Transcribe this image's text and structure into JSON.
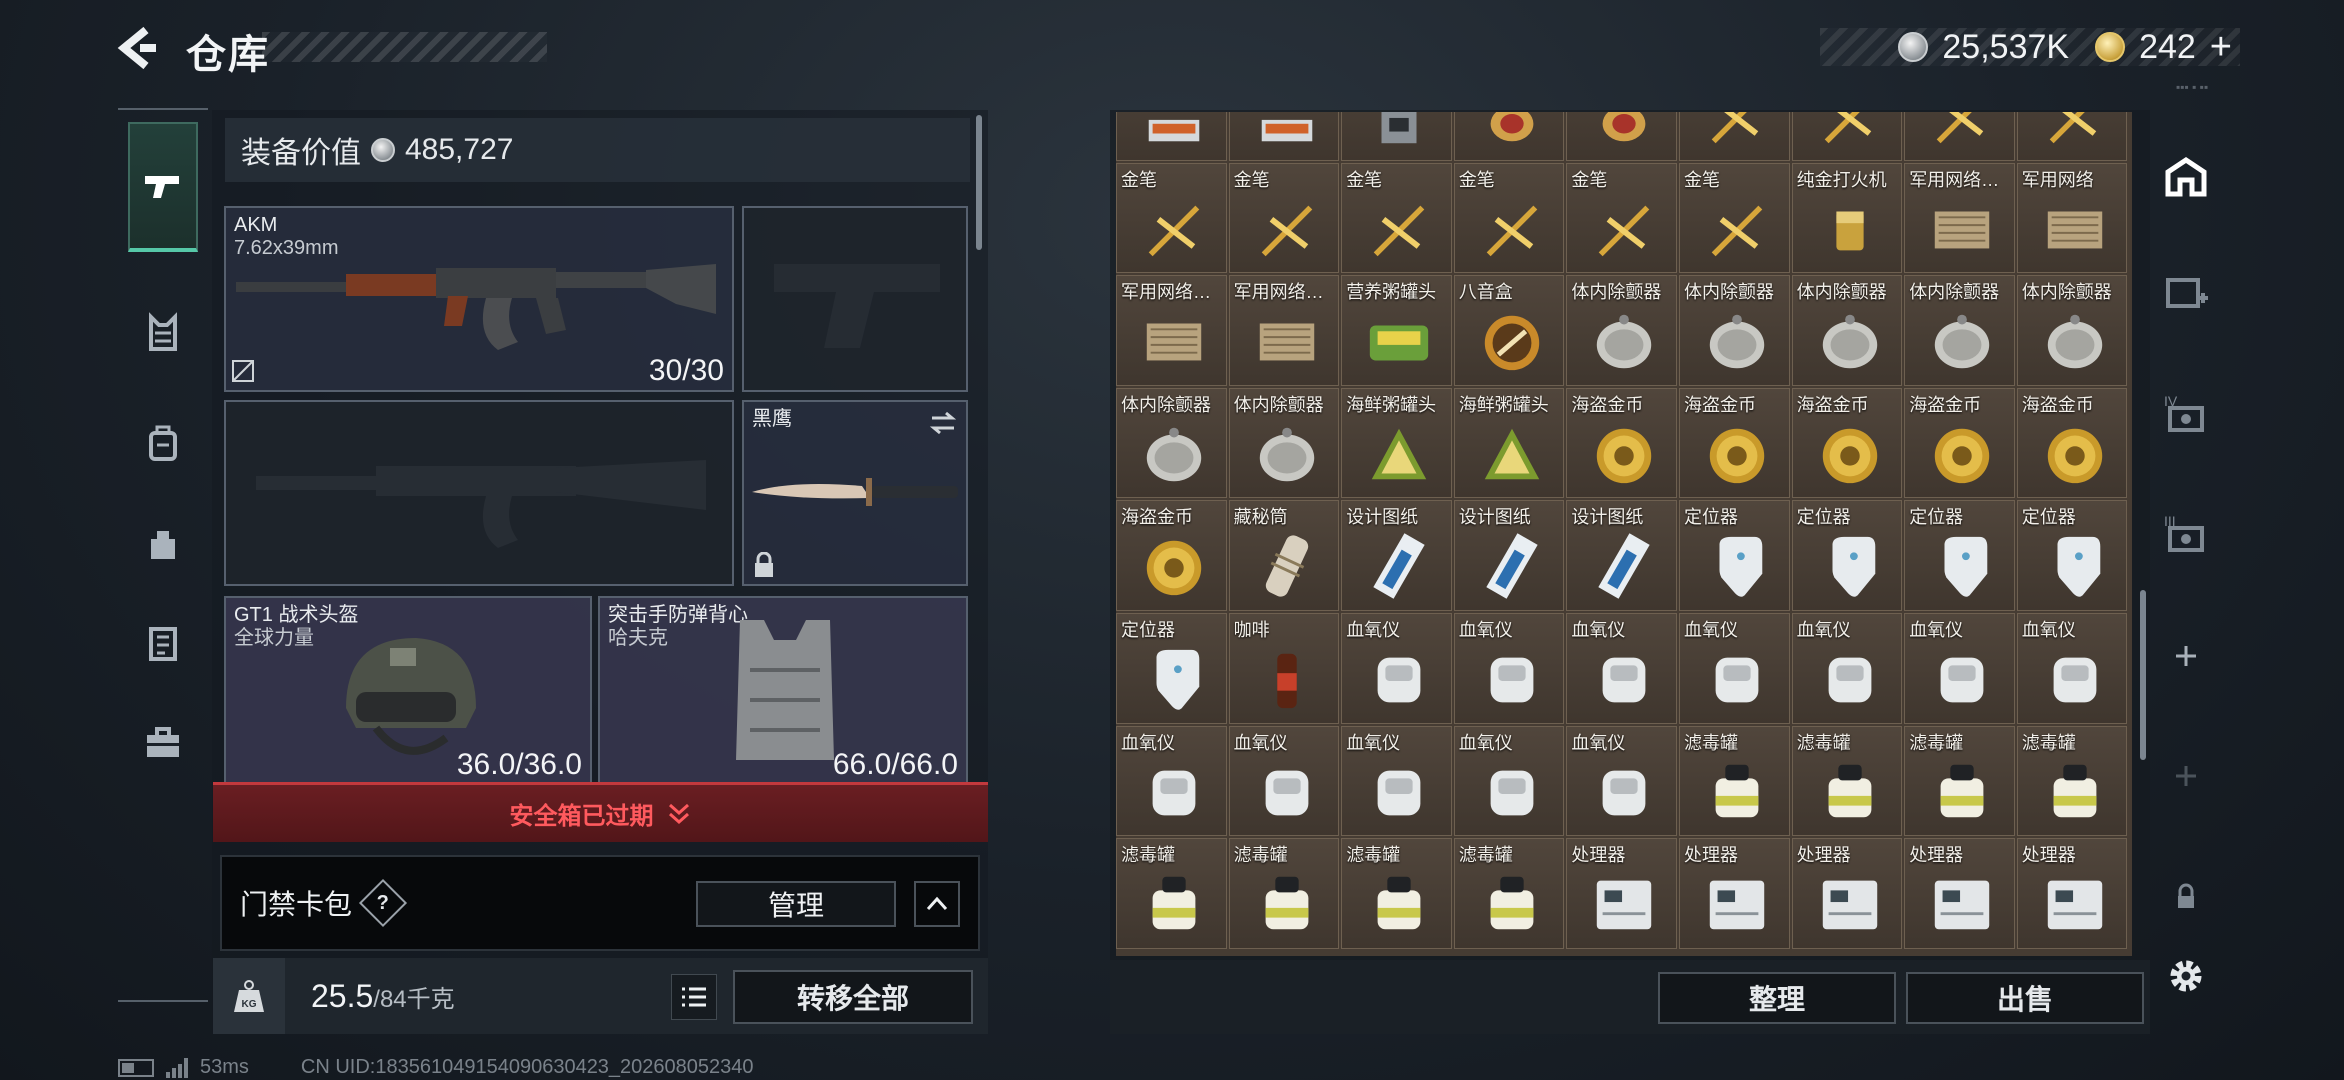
{
  "header": {
    "title": "仓库",
    "currencies": [
      {
        "icon": "silver-coin-icon",
        "value": "25,537K"
      },
      {
        "icon": "gold-coin-icon",
        "value": "242",
        "add": "+"
      }
    ]
  },
  "left_tabs": [
    {
      "name": "weapons",
      "icon": "pistol-icon",
      "active": true
    },
    {
      "name": "armor-rig",
      "icon": "chest-rig-icon"
    },
    {
      "name": "backpack",
      "icon": "backpack-icon"
    },
    {
      "name": "bag",
      "icon": "pouch-icon"
    },
    {
      "name": "clipboard",
      "icon": "clipboard-icon"
    },
    {
      "name": "toolbox",
      "icon": "briefcase-icon"
    }
  ],
  "equipment": {
    "value_label": "装备价值",
    "value": "485,727",
    "primary_weapon": {
      "name": "AKM",
      "ammo_type": "7.62x39mm",
      "ammo": "30/30"
    },
    "melee": {
      "name": "黑鹰"
    },
    "helmet": {
      "name": "GT1 战术头盔",
      "brand": "全球力量",
      "durability": "36.0/36.0"
    },
    "vest": {
      "name": "突击手防弹背心",
      "brand": "哈夫克",
      "durability": "66.0/66.0"
    }
  },
  "safebox": {
    "label": "安全箱已过期"
  },
  "keycard": {
    "label": "门禁卡包",
    "help": "?",
    "manage": "管理"
  },
  "weight": {
    "current": "25.5",
    "max": "/84千克",
    "icon_text": "KG"
  },
  "transfer_all": "转移全部",
  "status": {
    "ping": "53ms",
    "uid": "CN UID:1835610491540906304​23_202608052340"
  },
  "stash": {
    "rows": [
      [
        "",
        "",
        "",
        "",
        "",
        "",
        "",
        "",
        ""
      ],
      [
        "金笔",
        "金笔",
        "金笔",
        "金笔",
        "金笔",
        "金笔",
        "纯金打火机",
        "军用网络…",
        "军用网络"
      ],
      [
        "军用网络…",
        "军用网络…",
        "营养粥罐头",
        "八音盒",
        "体内除颤器",
        "体内除颤器",
        "体内除颤器",
        "体内除颤器",
        "体内除颤器"
      ],
      [
        "体内除颤器",
        "体内除颤器",
        "海鲜粥罐头",
        "海鲜粥罐头",
        "海盗金币",
        "海盗金币",
        "海盗金币",
        "海盗金币",
        "海盗金币"
      ],
      [
        "海盗金币",
        "藏秘筒",
        "设计图纸",
        "设计图纸",
        "设计图纸",
        "定位器",
        "定位器",
        "定位器",
        "定位器"
      ],
      [
        "定位器",
        "咖啡",
        "血氧仪",
        "血氧仪",
        "血氧仪",
        "血氧仪",
        "血氧仪",
        "血氧仪",
        "血氧仪"
      ],
      [
        "血氧仪",
        "血氧仪",
        "血氧仪",
        "血氧仪",
        "血氧仪",
        "滤毒罐",
        "滤毒罐",
        "滤毒罐",
        "滤毒罐"
      ],
      [
        "滤毒罐",
        "滤毒罐",
        "滤毒罐",
        "滤毒罐",
        "处理器",
        "处理器",
        "处理器",
        "处理器",
        "处理器"
      ]
    ],
    "top_row_art": [
      "ammo",
      "ammo",
      "device",
      "teapot",
      "teapot",
      "pen",
      "pen",
      "pen",
      "pen"
    ]
  },
  "actions": {
    "organize": "整理",
    "sell": "出售"
  },
  "right_tabs": [
    {
      "icon": "stash-home-icon",
      "active": true
    },
    {
      "icon": "add-container-icon"
    },
    {
      "icon": "stash-page-4-icon"
    },
    {
      "icon": "stash-page-3-icon"
    },
    {
      "icon": "plus-icon"
    },
    {
      "icon": "plus-icon"
    },
    {
      "icon": "lock-icon"
    },
    {
      "icon": "gear-icon"
    }
  ],
  "colors": {
    "accent_green": "#56c8a8",
    "warning_red": "#ff5a5e",
    "cell_brown": "#4a4036"
  }
}
